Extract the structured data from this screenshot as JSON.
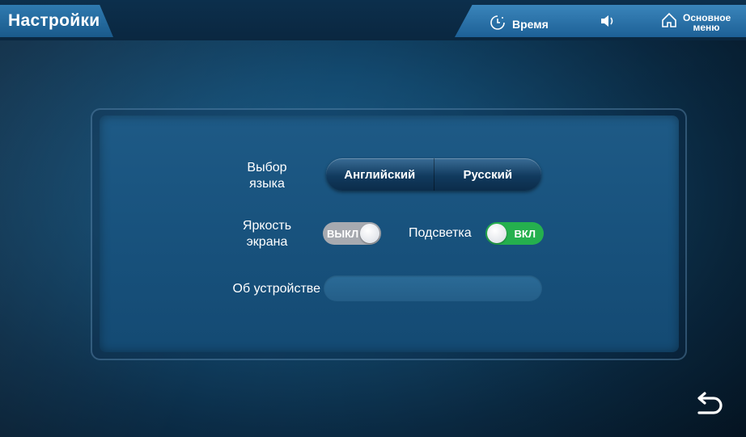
{
  "header": {
    "title": "Настройки",
    "time_label": "Время",
    "main_menu_line1": "Основное",
    "main_menu_line2": "меню"
  },
  "language": {
    "label_line1": "Выбор",
    "label_line2": "языка",
    "options": [
      "Английский",
      "Русский"
    ]
  },
  "brightness": {
    "label_line1": "Яркость",
    "label_line2": "экрана",
    "state": "ВЫКЛ"
  },
  "backlight": {
    "label": "Подсветка",
    "state": "ВКЛ"
  },
  "about": {
    "label": "Об устройстве",
    "value": ""
  },
  "icons": {
    "time": "clock-icon",
    "volume": "speaker-icon",
    "home": "home-icon",
    "back": "back-arrow-icon"
  },
  "colors": {
    "toggle_on": "#25b04e",
    "toggle_off": "#a7aab0",
    "accent": "#2f7ab0"
  }
}
